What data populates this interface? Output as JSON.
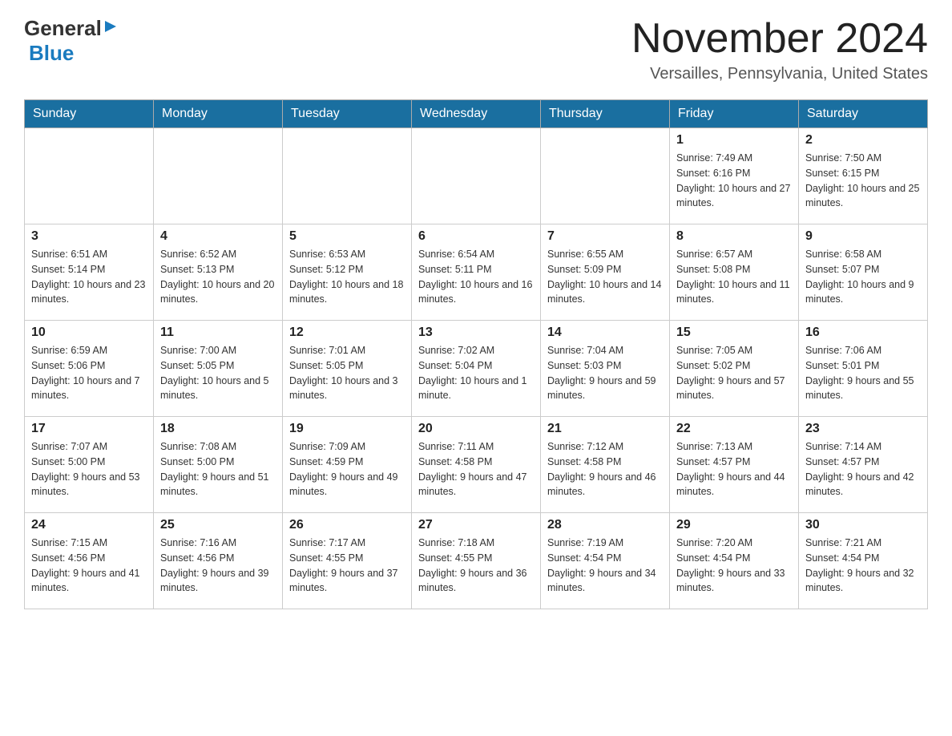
{
  "header": {
    "logo_general": "General",
    "logo_blue": "Blue",
    "month_title": "November 2024",
    "location": "Versailles, Pennsylvania, United States"
  },
  "days_of_week": [
    "Sunday",
    "Monday",
    "Tuesday",
    "Wednesday",
    "Thursday",
    "Friday",
    "Saturday"
  ],
  "weeks": [
    {
      "days": [
        {
          "num": "",
          "info": ""
        },
        {
          "num": "",
          "info": ""
        },
        {
          "num": "",
          "info": ""
        },
        {
          "num": "",
          "info": ""
        },
        {
          "num": "",
          "info": ""
        },
        {
          "num": "1",
          "info": "Sunrise: 7:49 AM\nSunset: 6:16 PM\nDaylight: 10 hours and 27 minutes."
        },
        {
          "num": "2",
          "info": "Sunrise: 7:50 AM\nSunset: 6:15 PM\nDaylight: 10 hours and 25 minutes."
        }
      ]
    },
    {
      "days": [
        {
          "num": "3",
          "info": "Sunrise: 6:51 AM\nSunset: 5:14 PM\nDaylight: 10 hours and 23 minutes."
        },
        {
          "num": "4",
          "info": "Sunrise: 6:52 AM\nSunset: 5:13 PM\nDaylight: 10 hours and 20 minutes."
        },
        {
          "num": "5",
          "info": "Sunrise: 6:53 AM\nSunset: 5:12 PM\nDaylight: 10 hours and 18 minutes."
        },
        {
          "num": "6",
          "info": "Sunrise: 6:54 AM\nSunset: 5:11 PM\nDaylight: 10 hours and 16 minutes."
        },
        {
          "num": "7",
          "info": "Sunrise: 6:55 AM\nSunset: 5:09 PM\nDaylight: 10 hours and 14 minutes."
        },
        {
          "num": "8",
          "info": "Sunrise: 6:57 AM\nSunset: 5:08 PM\nDaylight: 10 hours and 11 minutes."
        },
        {
          "num": "9",
          "info": "Sunrise: 6:58 AM\nSunset: 5:07 PM\nDaylight: 10 hours and 9 minutes."
        }
      ]
    },
    {
      "days": [
        {
          "num": "10",
          "info": "Sunrise: 6:59 AM\nSunset: 5:06 PM\nDaylight: 10 hours and 7 minutes."
        },
        {
          "num": "11",
          "info": "Sunrise: 7:00 AM\nSunset: 5:05 PM\nDaylight: 10 hours and 5 minutes."
        },
        {
          "num": "12",
          "info": "Sunrise: 7:01 AM\nSunset: 5:05 PM\nDaylight: 10 hours and 3 minutes."
        },
        {
          "num": "13",
          "info": "Sunrise: 7:02 AM\nSunset: 5:04 PM\nDaylight: 10 hours and 1 minute."
        },
        {
          "num": "14",
          "info": "Sunrise: 7:04 AM\nSunset: 5:03 PM\nDaylight: 9 hours and 59 minutes."
        },
        {
          "num": "15",
          "info": "Sunrise: 7:05 AM\nSunset: 5:02 PM\nDaylight: 9 hours and 57 minutes."
        },
        {
          "num": "16",
          "info": "Sunrise: 7:06 AM\nSunset: 5:01 PM\nDaylight: 9 hours and 55 minutes."
        }
      ]
    },
    {
      "days": [
        {
          "num": "17",
          "info": "Sunrise: 7:07 AM\nSunset: 5:00 PM\nDaylight: 9 hours and 53 minutes."
        },
        {
          "num": "18",
          "info": "Sunrise: 7:08 AM\nSunset: 5:00 PM\nDaylight: 9 hours and 51 minutes."
        },
        {
          "num": "19",
          "info": "Sunrise: 7:09 AM\nSunset: 4:59 PM\nDaylight: 9 hours and 49 minutes."
        },
        {
          "num": "20",
          "info": "Sunrise: 7:11 AM\nSunset: 4:58 PM\nDaylight: 9 hours and 47 minutes."
        },
        {
          "num": "21",
          "info": "Sunrise: 7:12 AM\nSunset: 4:58 PM\nDaylight: 9 hours and 46 minutes."
        },
        {
          "num": "22",
          "info": "Sunrise: 7:13 AM\nSunset: 4:57 PM\nDaylight: 9 hours and 44 minutes."
        },
        {
          "num": "23",
          "info": "Sunrise: 7:14 AM\nSunset: 4:57 PM\nDaylight: 9 hours and 42 minutes."
        }
      ]
    },
    {
      "days": [
        {
          "num": "24",
          "info": "Sunrise: 7:15 AM\nSunset: 4:56 PM\nDaylight: 9 hours and 41 minutes."
        },
        {
          "num": "25",
          "info": "Sunrise: 7:16 AM\nSunset: 4:56 PM\nDaylight: 9 hours and 39 minutes."
        },
        {
          "num": "26",
          "info": "Sunrise: 7:17 AM\nSunset: 4:55 PM\nDaylight: 9 hours and 37 minutes."
        },
        {
          "num": "27",
          "info": "Sunrise: 7:18 AM\nSunset: 4:55 PM\nDaylight: 9 hours and 36 minutes."
        },
        {
          "num": "28",
          "info": "Sunrise: 7:19 AM\nSunset: 4:54 PM\nDaylight: 9 hours and 34 minutes."
        },
        {
          "num": "29",
          "info": "Sunrise: 7:20 AM\nSunset: 4:54 PM\nDaylight: 9 hours and 33 minutes."
        },
        {
          "num": "30",
          "info": "Sunrise: 7:21 AM\nSunset: 4:54 PM\nDaylight: 9 hours and 32 minutes."
        }
      ]
    }
  ]
}
